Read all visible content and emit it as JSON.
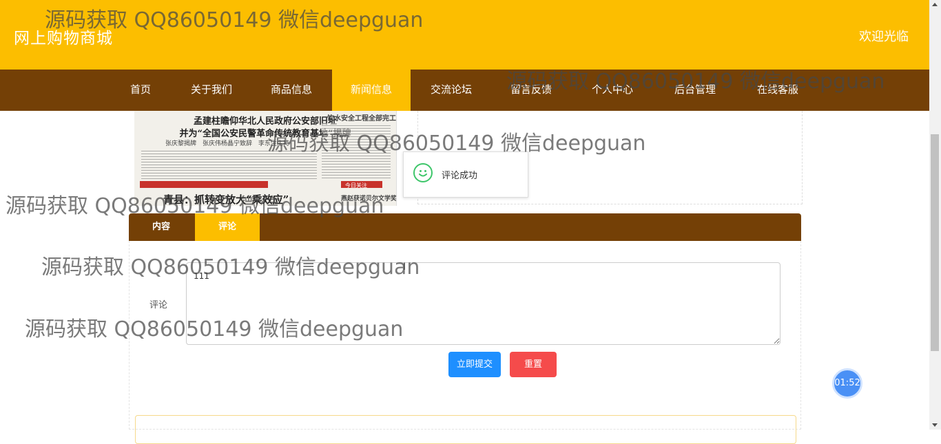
{
  "header": {
    "site_title": "网上购物商城",
    "welcome": "欢迎光临"
  },
  "nav": {
    "items": [
      "首页",
      "关于我们",
      "商品信息",
      "新闻信息",
      "交流论坛",
      "留言反馈",
      "个人中心",
      "后台管理",
      "在线客服"
    ],
    "active": "新闻信息"
  },
  "news_image": {
    "headline_1": "孟建柱瞻仰华北人民政府公安部旧址",
    "headline_2": "并为“全国公安民警革命传统教育基地”揭牌",
    "byline": "张庆黎揭牌　张庆伟杨晶宁致辞　李东生主持",
    "side_title": "饮水安全工程全部完工",
    "bottom_headline": "青县：抓转变放大“乘效应”",
    "side_tag": "今日关注",
    "side_bottom": "燕赵获诺贝尔文学奖"
  },
  "toast": {
    "icon": "smile-icon",
    "message": "评论成功"
  },
  "tabs": {
    "items": [
      "内容",
      "评论"
    ],
    "active": "评论"
  },
  "comment_form": {
    "label": "评论",
    "value": "111",
    "submit_label": "立即提交",
    "reset_label": "重置"
  },
  "timer": {
    "value": "01:52"
  },
  "watermarks": [
    "源码获取 QQ86050149 微信deepguan",
    "源码获取 QQ86050149 微信deepguan",
    "源码获取 QQ86050149 微信deepguan",
    "源码获取 QQ86050149 微信deepguan",
    "源码获取 QQ86050149 微信deepguan",
    "源码获取 QQ86050149 微信deepguan"
  ],
  "colors": {
    "header_bg": "#fcbe00",
    "nav_bg": "#744006",
    "active_bg": "#fcbe00",
    "submit_bg": "#1e8fff",
    "reset_bg": "#f54b4b",
    "timer_bg": "#4a90f5"
  }
}
